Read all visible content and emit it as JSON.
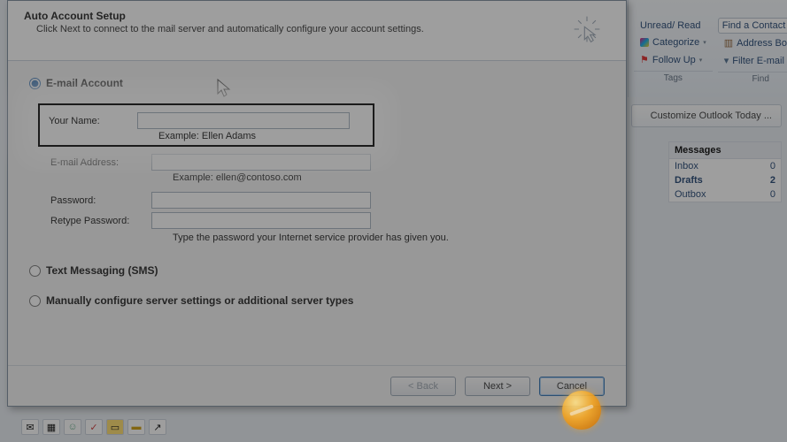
{
  "titlebar": {
    "expand_icon": "⌄",
    "help_icon": "?"
  },
  "ribbon": {
    "tags": {
      "unread_read": "Unread/ Read",
      "categorize": "Categorize",
      "follow_up": "Follow Up",
      "group_label": "Tags"
    },
    "find": {
      "contact_placeholder": "Find a Contact",
      "address_book": "Address Book",
      "filter": "Filter E-mail",
      "group_label": "Find"
    }
  },
  "side": {
    "customize": "Customize Outlook Today ...",
    "messages_header": "Messages",
    "rows": [
      {
        "label": "Inbox",
        "count": "0",
        "bold": false
      },
      {
        "label": "Drafts",
        "count": "2",
        "bold": true
      },
      {
        "label": "Outbox",
        "count": "0",
        "bold": false
      }
    ]
  },
  "dialog": {
    "title": "Auto Account Setup",
    "subtitle": "Click Next to connect to the mail server and automatically configure your account settings.",
    "options": {
      "email": "E-mail Account",
      "sms": "Text Messaging (SMS)",
      "manual": "Manually configure server settings or additional server types"
    },
    "form": {
      "name_label": "Your Name:",
      "name_hint": "Example: Ellen Adams",
      "email_label": "E-mail Address:",
      "email_hint": "Example: ellen@contoso.com",
      "password_label": "Password:",
      "retype_label": "Retype Password:",
      "password_hint": "Type the password your Internet service provider has given you."
    },
    "buttons": {
      "back": "< Back",
      "next": "Next >",
      "cancel": "Cancel"
    }
  },
  "bottom_icons": [
    "✉",
    "▦",
    "👤",
    "✓",
    "📁",
    "↗"
  ]
}
